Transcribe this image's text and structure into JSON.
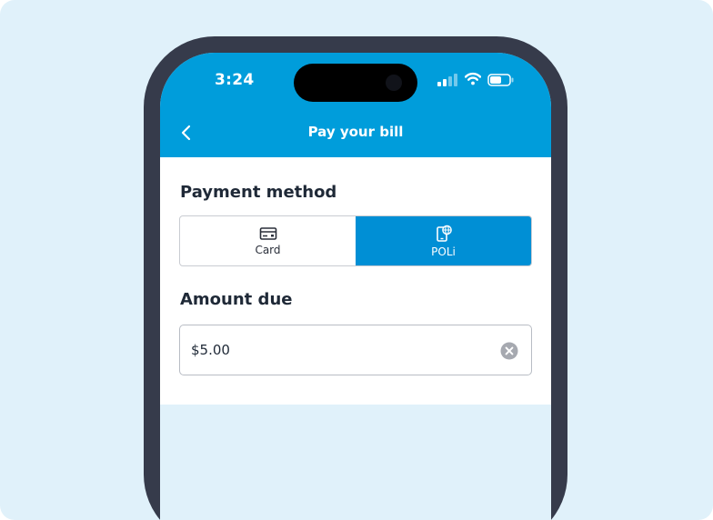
{
  "status_bar": {
    "time": "3:24",
    "icons": [
      "signal-icon",
      "wifi-icon",
      "battery-icon"
    ]
  },
  "header": {
    "title": "Pay your bill",
    "back_icon": "chevron-left-icon"
  },
  "payment_method": {
    "label": "Payment method",
    "options": [
      {
        "label": "Card",
        "icon": "credit-card-icon",
        "selected": false
      },
      {
        "label": "POLi",
        "icon": "mobile-web-icon",
        "selected": true
      }
    ]
  },
  "amount_due": {
    "label": "Amount due",
    "value": "$5.00",
    "clear_icon": "clear-icon"
  },
  "colors": {
    "accent": "#009ddb",
    "selected_segment": "#008fd5",
    "frame": "#363b4b",
    "background": "#e0f1fa"
  }
}
